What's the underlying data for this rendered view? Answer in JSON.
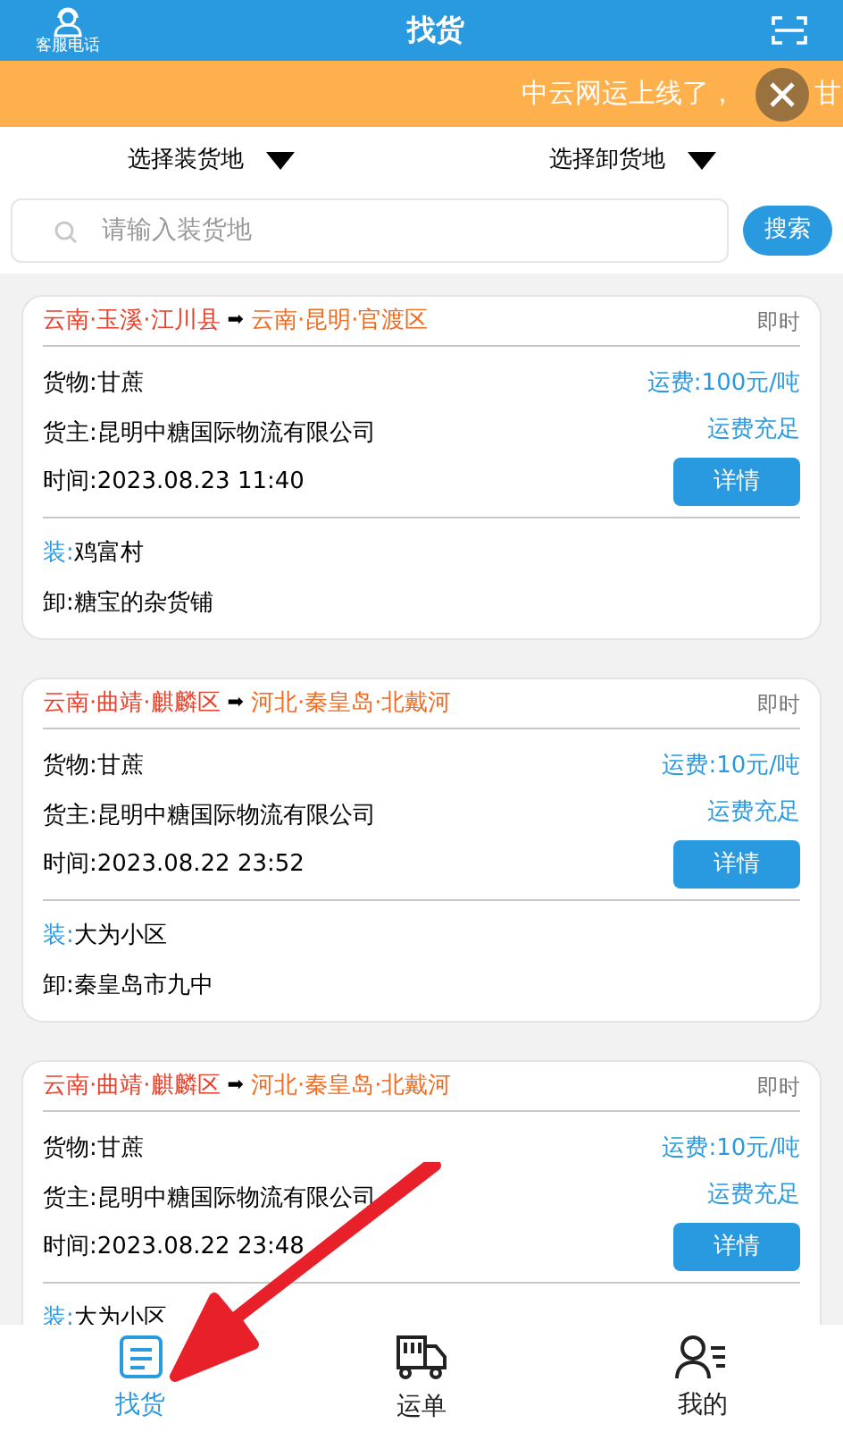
{
  "header": {
    "service_label": "客服电话",
    "title": "找货"
  },
  "banner": {
    "text": "中云网运上线了，",
    "tail": "甘"
  },
  "filters": [
    {
      "label": "选择装货地"
    },
    {
      "label": "选择卸货地"
    }
  ],
  "search": {
    "placeholder": "请输入装货地",
    "button": "搜索"
  },
  "orders": [
    {
      "from": "云南·玉溪·江川县",
      "arrow": "➡",
      "to": "云南·昆明·官渡区",
      "type": "即时",
      "cargo": "货物:甘蔗",
      "owner": "货主:昆明中糖国际物流有限公司",
      "time": "时间:2023.08.23 11:40",
      "fee": "运费:100元/吨",
      "fee_status": "运费充足",
      "details": "详情",
      "load_label": "装:",
      "load": "鸡富村",
      "unload": "卸:糖宝的杂货铺"
    },
    {
      "from": "云南·曲靖·麒麟区",
      "arrow": "➡",
      "to": "河北·秦皇岛·北戴河",
      "type": "即时",
      "cargo": "货物:甘蔗",
      "owner": "货主:昆明中糖国际物流有限公司",
      "time": "时间:2023.08.22 23:52",
      "fee": "运费:10元/吨",
      "fee_status": "运费充足",
      "details": "详情",
      "load_label": "装:",
      "load": "大为小区",
      "unload": "卸:秦皇岛市九中"
    },
    {
      "from": "云南·曲靖·麒麟区",
      "arrow": "➡",
      "to": "河北·秦皇岛·北戴河",
      "type": "即时",
      "cargo": "货物:甘蔗",
      "owner": "货主:昆明中糖国际物流有限公司",
      "time": "时间:2023.08.22 23:48",
      "fee": "运费:10元/吨",
      "fee_status": "运费充足",
      "details": "详情",
      "load_label": "装:",
      "load": "大为小区"
    }
  ],
  "tabs": [
    {
      "label": "找货",
      "kind": "list",
      "selected": true
    },
    {
      "label": "运单",
      "kind": "truck",
      "selected": false
    },
    {
      "label": "我的",
      "kind": "user",
      "selected": false
    }
  ]
}
